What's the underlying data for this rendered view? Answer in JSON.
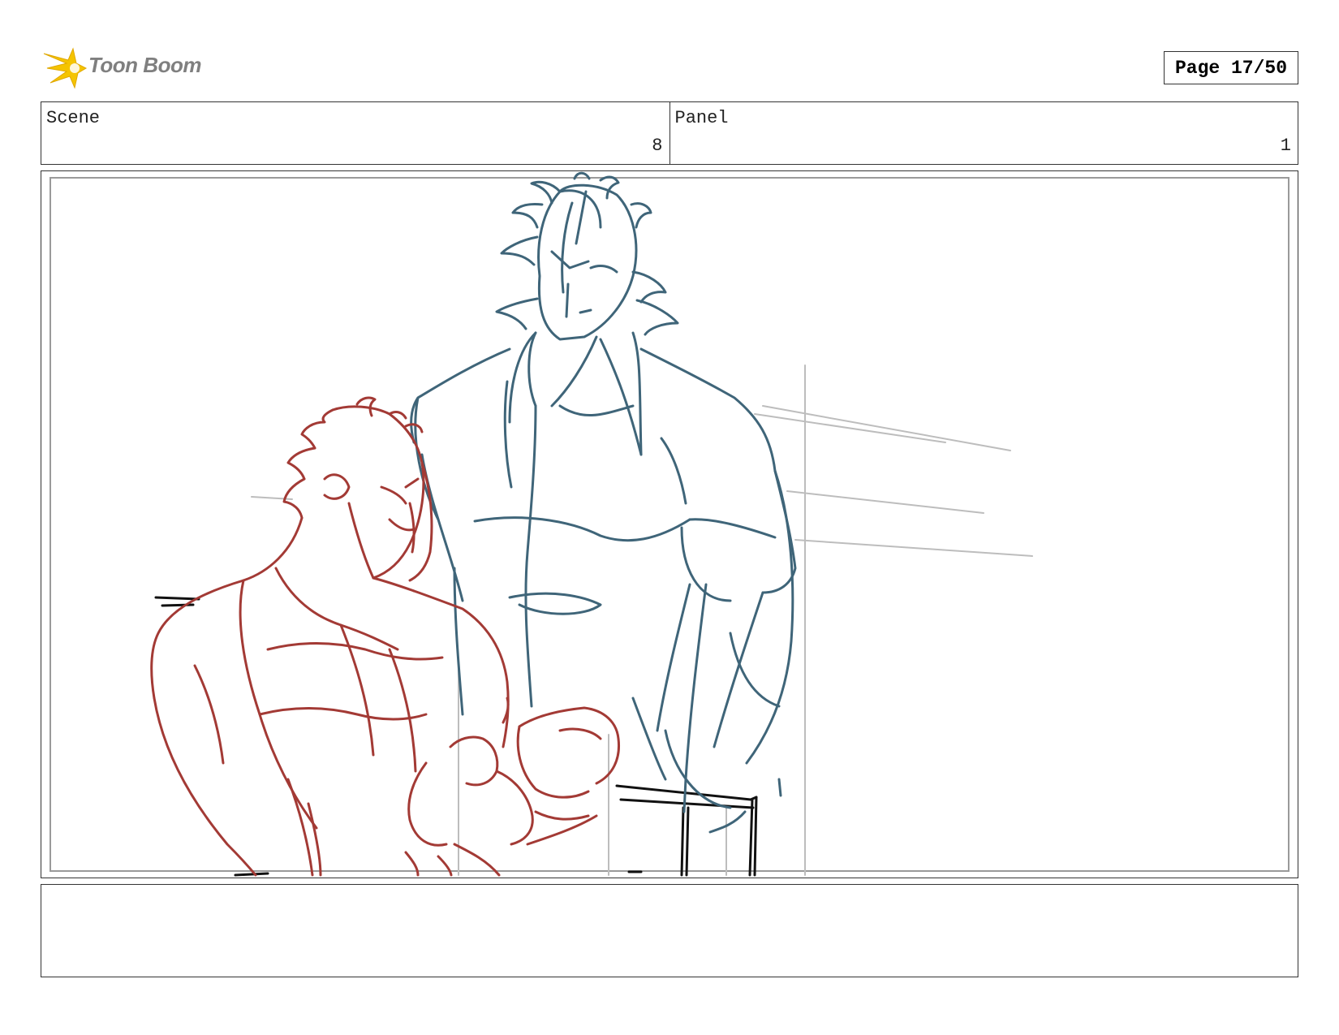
{
  "header": {
    "logo_text": "Toon Boom",
    "page_label": "Page 17/50"
  },
  "scene": {
    "label": "Scene",
    "value": "8"
  },
  "panel": {
    "label": "Panel",
    "value": "1"
  },
  "notes": {
    "text": ""
  },
  "colors": {
    "sketch_red": "#a33a35",
    "sketch_blue": "#3f6579",
    "guide_gray": "#bdbdbd",
    "ink_black": "#111111",
    "logo_yellow": "#f5c400",
    "logo_text": "#7f7f7f"
  }
}
